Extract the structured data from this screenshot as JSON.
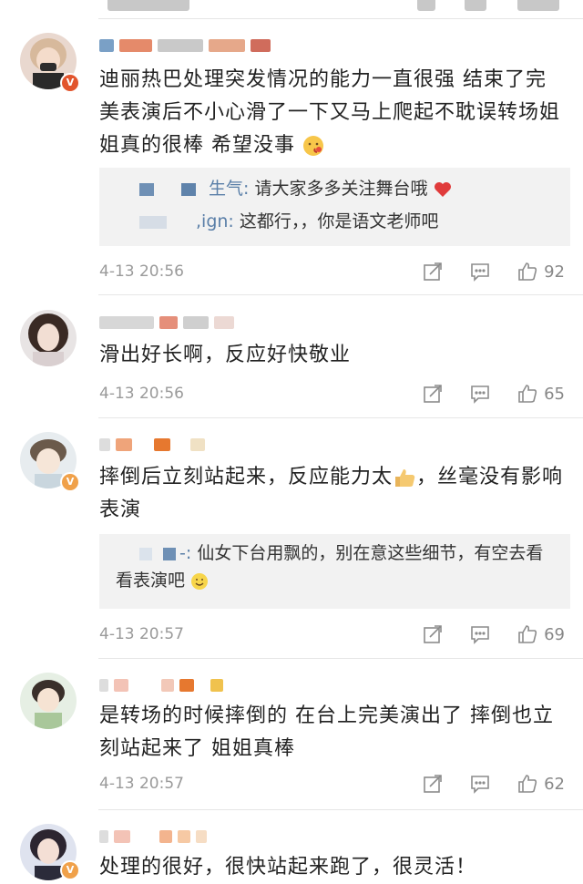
{
  "comments": [
    {
      "text": "迪丽热巴处理突发情况的能力一直很强 结束了完美表演后不小心滑了一下又马上爬起不耽误转场姐姐真的很棒 希望没事",
      "replies": [
        {
          "name": "生气:",
          "text": "请大家多多关注舞台哦"
        },
        {
          "name": ",ign:",
          "text": "这都行，，你是语文老师吧"
        }
      ],
      "time": "4-13 20:56",
      "likes": "92"
    },
    {
      "text": "滑出好长啊，反应好快敬业",
      "time": "4-13 20:56",
      "likes": "65"
    },
    {
      "text_a": "摔倒后立刻站起来，反应能力太",
      "text_b": "，丝毫没有影响表演",
      "replies": [
        {
          "name": "-:",
          "text": "仙女下台用飘的，别在意这些细节，有空去看看表演吧"
        }
      ],
      "time": "4-13 20:57",
      "likes": "69"
    },
    {
      "text": "是转场的时候摔倒的 在台上完美演出了 摔倒也立刻站起来了 姐姐真棒",
      "time": "4-13 20:57",
      "likes": "62"
    },
    {
      "text": "处理的很好，很快站起来跑了，很灵活！"
    }
  ],
  "icons": [
    "share-icon",
    "comment-icon",
    "like-icon",
    "verified-badge-icon"
  ],
  "colors": {
    "reply_name": "#5a7fa8",
    "meta": "#9a9a9a",
    "reply_bg": "#f2f2f2",
    "badge_orange": "#f0a14a",
    "badge_red": "#e2552d"
  }
}
